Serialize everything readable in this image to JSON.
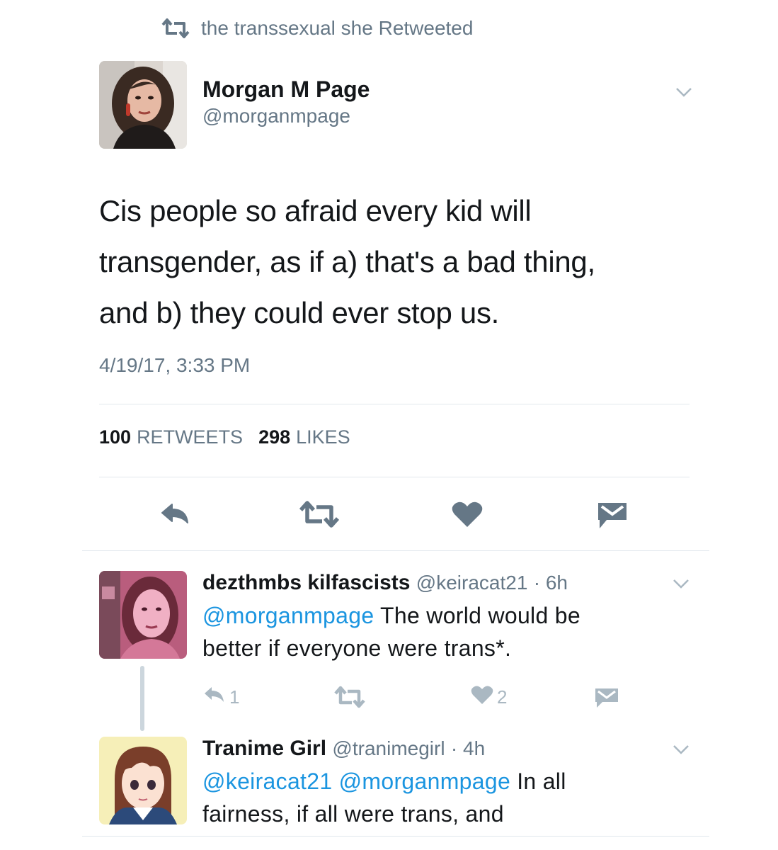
{
  "retweet_context": {
    "text": "the transsexual she Retweeted",
    "icon": "retweet-icon"
  },
  "main_tweet": {
    "author_name": "Morgan M Page",
    "author_handle": "@morganmpage",
    "text_lines": [
      "Cis people so afraid every kid will",
      "transgender, as if a) that's a bad thing,",
      "and b) they could ever stop us."
    ],
    "timestamp": "4/19/17, 3:33 PM",
    "retweets_count": "100",
    "retweets_label": "RETWEETS",
    "likes_count": "298",
    "likes_label": "LIKES",
    "actions": [
      "reply-icon",
      "retweet-icon",
      "heart-icon",
      "direct-message-icon"
    ]
  },
  "replies": [
    {
      "author_name": "dezthmbs kilfascists",
      "author_handle": "@keiracat21",
      "time": "· 6h",
      "mention": "@morganmpage",
      "text_after_mention": " The world would be",
      "text_line2": "better if everyone were trans*.",
      "reply_count": "1",
      "like_count": "2"
    },
    {
      "author_name": "Tranime Girl",
      "author_handle": "@tranimegirl",
      "time": "· 4h",
      "mentions": "@keiracat21 @morganmpage",
      "text_after_mention": " In all",
      "text_line2": "fairness, if all were trans, and"
    }
  ],
  "colors": {
    "text_primary": "#14171a",
    "text_secondary": "#657786",
    "mention_blue": "#1b95e0",
    "icon_gray": "#657786",
    "icon_light": "#aab8c2",
    "divider": "#e1e8ed"
  }
}
